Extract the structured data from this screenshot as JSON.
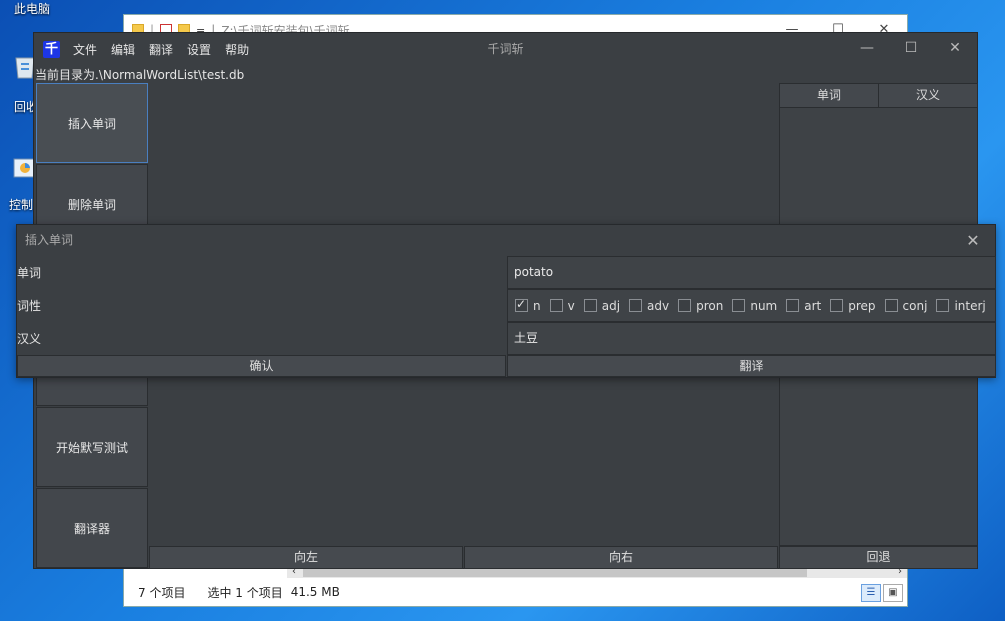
{
  "desktop": {
    "icons": [
      {
        "label": "此电脑"
      },
      {
        "label": "回收"
      },
      {
        "label": "控制"
      }
    ]
  },
  "explorer": {
    "title": "Z:\\千词斩安装包\\千词斩",
    "status": {
      "items": "7 个项目",
      "selected": "选中 1 个项目",
      "size": "41.5 MB"
    }
  },
  "app": {
    "title": "千词斩",
    "logo": "千",
    "menu": [
      "文件",
      "编辑",
      "翻译",
      "设置",
      "帮助"
    ],
    "current_dir": "当前目录为.\\NormalWordList\\test.db",
    "side_buttons": [
      "插入单词",
      "删除单词",
      "开始默写测试",
      "翻译器"
    ],
    "table_headers": [
      "单词",
      "汉义"
    ],
    "bottom_buttons": {
      "left": "向左",
      "right": "向右",
      "undo": "回退"
    }
  },
  "dialog": {
    "title": "插入单词",
    "labels": {
      "word": "单词",
      "pos": "词性",
      "meaning": "汉义"
    },
    "word_value": "potato",
    "meaning_value": "土豆",
    "pos_options": [
      {
        "label": "n",
        "checked": true
      },
      {
        "label": "v",
        "checked": false
      },
      {
        "label": "adj",
        "checked": false
      },
      {
        "label": "adv",
        "checked": false
      },
      {
        "label": "pron",
        "checked": false
      },
      {
        "label": "num",
        "checked": false
      },
      {
        "label": "art",
        "checked": false
      },
      {
        "label": "prep",
        "checked": false
      },
      {
        "label": "conj",
        "checked": false
      },
      {
        "label": "interj",
        "checked": false
      }
    ],
    "confirm_label": "确认",
    "translate_label": "翻译"
  }
}
